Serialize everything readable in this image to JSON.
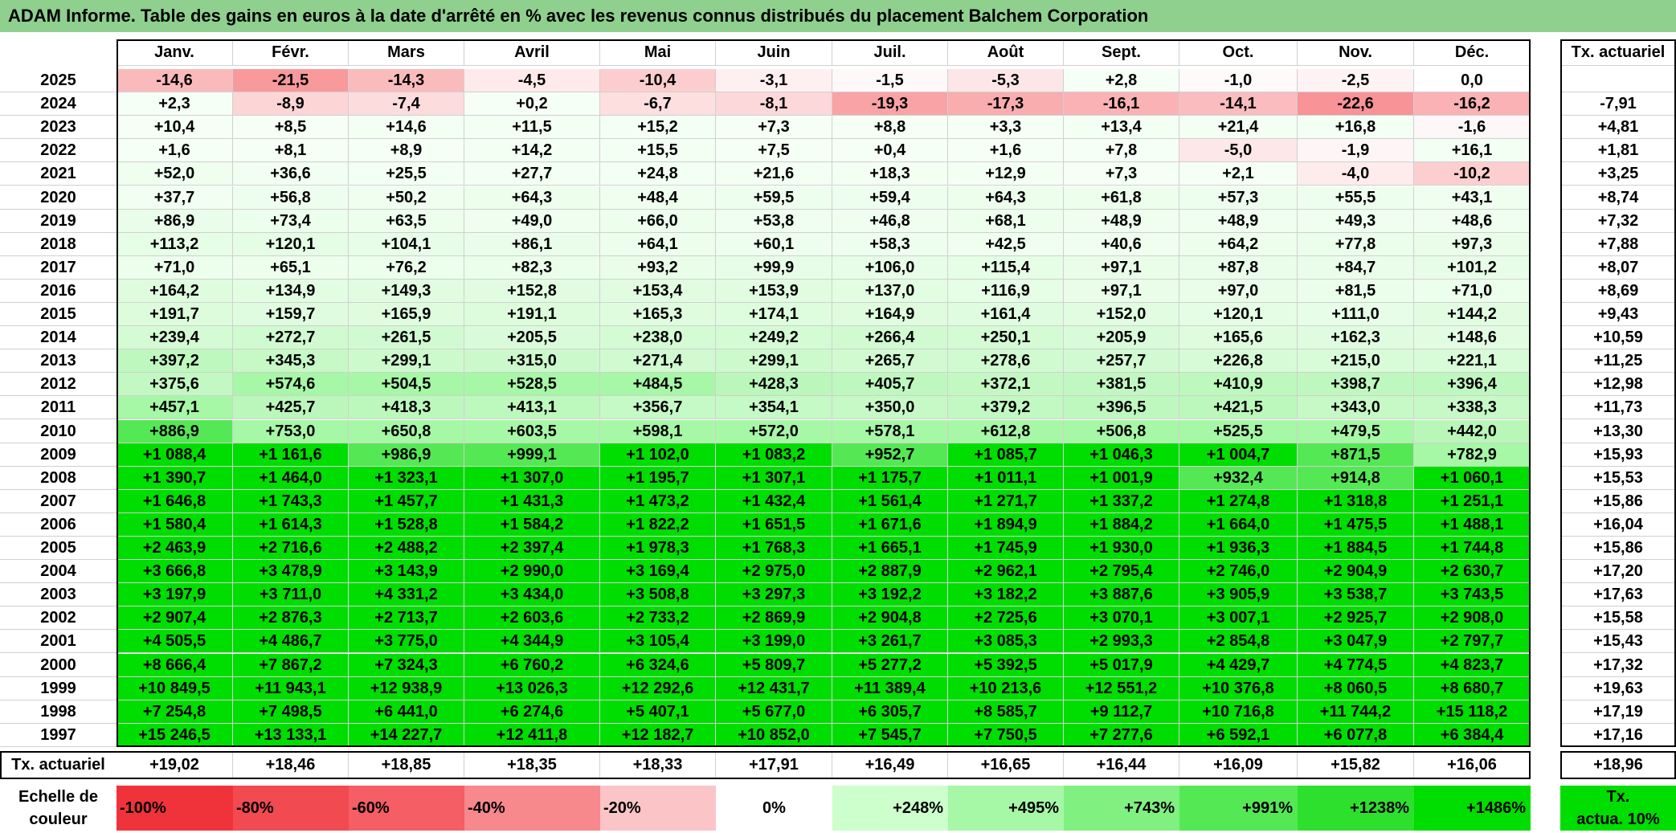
{
  "title": "ADAM Informe. Table des gains en euros à la date d'arrêté en % avec les revenus connus distribués du placement Balchem Corporation",
  "chart_data": {
    "type": "heatmap",
    "columns": [
      "Janv.",
      "Févr.",
      "Mars",
      "Avril",
      "Mai",
      "Juin",
      "Juil.",
      "Août",
      "Sept.",
      "Oct.",
      "Nov.",
      "Déc."
    ],
    "annual_header": "Tx. actuariel",
    "rows": [
      {
        "year": "2025",
        "values": [
          "-14,6",
          "-21,5",
          "-14,3",
          "-4,5",
          "-10,4",
          "-3,1",
          "-1,5",
          "-5,3",
          "+2,8",
          "-1,0",
          "-2,5",
          "0,0"
        ],
        "rate": ""
      },
      {
        "year": "2024",
        "values": [
          "+2,3",
          "-8,9",
          "-7,4",
          "+0,2",
          "-6,7",
          "-8,1",
          "-19,3",
          "-17,3",
          "-16,1",
          "-14,1",
          "-22,6",
          "-16,2"
        ],
        "rate": "-7,91"
      },
      {
        "year": "2023",
        "values": [
          "+10,4",
          "+8,5",
          "+14,6",
          "+11,5",
          "+15,2",
          "+7,3",
          "+8,8",
          "+3,3",
          "+13,4",
          "+21,4",
          "+16,8",
          "-1,6"
        ],
        "rate": "+4,81"
      },
      {
        "year": "2022",
        "values": [
          "+1,6",
          "+8,1",
          "+8,9",
          "+14,2",
          "+15,5",
          "+7,5",
          "+0,4",
          "+1,6",
          "+7,8",
          "-5,0",
          "-1,9",
          "+16,1"
        ],
        "rate": "+1,81"
      },
      {
        "year": "2021",
        "values": [
          "+52,0",
          "+36,6",
          "+25,5",
          "+27,7",
          "+24,8",
          "+21,6",
          "+18,3",
          "+12,9",
          "+7,3",
          "+2,1",
          "-4,0",
          "-10,2"
        ],
        "rate": "+3,25"
      },
      {
        "year": "2020",
        "values": [
          "+37,7",
          "+56,8",
          "+50,2",
          "+64,3",
          "+48,4",
          "+59,5",
          "+59,4",
          "+64,3",
          "+61,8",
          "+57,3",
          "+55,5",
          "+43,1"
        ],
        "rate": "+8,74"
      },
      {
        "year": "2019",
        "values": [
          "+86,9",
          "+73,4",
          "+63,5",
          "+49,0",
          "+66,0",
          "+53,8",
          "+46,8",
          "+68,1",
          "+48,9",
          "+48,9",
          "+49,3",
          "+48,6"
        ],
        "rate": "+7,32"
      },
      {
        "year": "2018",
        "values": [
          "+113,2",
          "+120,1",
          "+104,1",
          "+86,1",
          "+64,1",
          "+60,1",
          "+58,3",
          "+42,5",
          "+40,6",
          "+64,2",
          "+77,8",
          "+97,3"
        ],
        "rate": "+7,88"
      },
      {
        "year": "2017",
        "values": [
          "+71,0",
          "+65,1",
          "+76,2",
          "+82,3",
          "+93,2",
          "+99,9",
          "+106,0",
          "+115,4",
          "+97,1",
          "+87,8",
          "+84,7",
          "+101,2"
        ],
        "rate": "+8,07"
      },
      {
        "year": "2016",
        "values": [
          "+164,2",
          "+134,9",
          "+149,3",
          "+152,8",
          "+153,4",
          "+153,9",
          "+137,0",
          "+116,9",
          "+97,1",
          "+97,0",
          "+81,5",
          "+71,0"
        ],
        "rate": "+8,69"
      },
      {
        "year": "2015",
        "values": [
          "+191,7",
          "+159,7",
          "+165,9",
          "+191,1",
          "+165,3",
          "+174,1",
          "+164,9",
          "+161,4",
          "+152,0",
          "+120,1",
          "+111,0",
          "+144,2"
        ],
        "rate": "+9,43"
      },
      {
        "year": "2014",
        "values": [
          "+239,4",
          "+272,7",
          "+261,5",
          "+205,5",
          "+238,0",
          "+249,2",
          "+266,4",
          "+250,1",
          "+205,9",
          "+165,6",
          "+162,3",
          "+148,6"
        ],
        "rate": "+10,59"
      },
      {
        "year": "2013",
        "values": [
          "+397,2",
          "+345,3",
          "+299,1",
          "+315,0",
          "+271,4",
          "+299,1",
          "+265,7",
          "+278,6",
          "+257,7",
          "+226,8",
          "+215,0",
          "+221,1"
        ],
        "rate": "+11,25"
      },
      {
        "year": "2012",
        "values": [
          "+375,6",
          "+574,6",
          "+504,5",
          "+528,5",
          "+484,5",
          "+428,3",
          "+405,7",
          "+372,1",
          "+381,5",
          "+410,9",
          "+398,7",
          "+396,4"
        ],
        "rate": "+12,98"
      },
      {
        "year": "2011",
        "values": [
          "+457,1",
          "+425,7",
          "+418,3",
          "+413,1",
          "+356,7",
          "+354,1",
          "+350,0",
          "+379,2",
          "+396,5",
          "+421,5",
          "+343,0",
          "+338,3"
        ],
        "rate": "+11,73"
      },
      {
        "year": "2010",
        "values": [
          "+886,9",
          "+753,0",
          "+650,8",
          "+603,5",
          "+598,1",
          "+572,0",
          "+578,1",
          "+612,8",
          "+506,8",
          "+525,5",
          "+479,5",
          "+442,0"
        ],
        "rate": "+13,30"
      },
      {
        "year": "2009",
        "values": [
          "+1 088,4",
          "+1 161,6",
          "+986,9",
          "+999,1",
          "+1 102,0",
          "+1 083,2",
          "+952,7",
          "+1 085,7",
          "+1 046,3",
          "+1 004,7",
          "+871,5",
          "+782,9"
        ],
        "rate": "+15,93"
      },
      {
        "year": "2008",
        "values": [
          "+1 390,7",
          "+1 464,0",
          "+1 323,1",
          "+1 307,0",
          "+1 195,7",
          "+1 307,1",
          "+1 175,7",
          "+1 011,1",
          "+1 001,9",
          "+932,4",
          "+914,8",
          "+1 060,1"
        ],
        "rate": "+15,53"
      },
      {
        "year": "2007",
        "values": [
          "+1 646,8",
          "+1 743,3",
          "+1 457,7",
          "+1 431,3",
          "+1 473,2",
          "+1 432,4",
          "+1 561,4",
          "+1 271,7",
          "+1 337,2",
          "+1 274,8",
          "+1 318,8",
          "+1 251,1"
        ],
        "rate": "+15,86"
      },
      {
        "year": "2006",
        "values": [
          "+1 580,4",
          "+1 614,3",
          "+1 528,8",
          "+1 584,2",
          "+1 822,2",
          "+1 651,5",
          "+1 671,6",
          "+1 894,9",
          "+1 884,2",
          "+1 664,0",
          "+1 475,5",
          "+1 488,1"
        ],
        "rate": "+16,04"
      },
      {
        "year": "2005",
        "values": [
          "+2 463,9",
          "+2 716,6",
          "+2 488,2",
          "+2 397,4",
          "+1 978,3",
          "+1 768,3",
          "+1 665,1",
          "+1 745,9",
          "+1 930,0",
          "+1 936,3",
          "+1 884,5",
          "+1 744,8"
        ],
        "rate": "+15,86"
      },
      {
        "year": "2004",
        "values": [
          "+3 666,8",
          "+3 478,9",
          "+3 143,9",
          "+2 990,0",
          "+3 169,4",
          "+2 975,0",
          "+2 887,9",
          "+2 962,1",
          "+2 795,4",
          "+2 746,0",
          "+2 904,9",
          "+2 630,7"
        ],
        "rate": "+17,20"
      },
      {
        "year": "2003",
        "values": [
          "+3 197,9",
          "+3 711,0",
          "+4 331,2",
          "+3 434,0",
          "+3 508,8",
          "+3 297,3",
          "+3 192,2",
          "+3 182,2",
          "+3 887,6",
          "+3 905,9",
          "+3 538,7",
          "+3 743,5"
        ],
        "rate": "+17,63"
      },
      {
        "year": "2002",
        "values": [
          "+2 907,4",
          "+2 876,3",
          "+2 713,7",
          "+2 603,6",
          "+2 733,2",
          "+2 869,9",
          "+2 904,8",
          "+2 725,6",
          "+3 070,1",
          "+3 007,1",
          "+2 925,7",
          "+2 908,0"
        ],
        "rate": "+15,58"
      },
      {
        "year": "2001",
        "values": [
          "+4 505,5",
          "+4 486,7",
          "+3 775,0",
          "+4 344,9",
          "+3 105,4",
          "+3 199,0",
          "+3 261,7",
          "+3 085,3",
          "+2 993,3",
          "+2 854,8",
          "+3 047,9",
          "+2 797,7"
        ],
        "rate": "+15,43"
      },
      {
        "year": "2000",
        "values": [
          "+8 666,4",
          "+7 867,2",
          "+7 324,3",
          "+6 760,2",
          "+6 324,6",
          "+5 809,7",
          "+5 277,2",
          "+5 392,5",
          "+5 017,9",
          "+4 429,7",
          "+4 774,5",
          "+4 823,7"
        ],
        "rate": "+17,32"
      },
      {
        "year": "1999",
        "values": [
          "+10 849,5",
          "+11 943,1",
          "+12 938,9",
          "+13 026,3",
          "+12 292,6",
          "+12 431,7",
          "+11 389,4",
          "+10 213,6",
          "+12 551,2",
          "+10 376,8",
          "+8 060,5",
          "+8 680,7"
        ],
        "rate": "+19,63"
      },
      {
        "year": "1998",
        "values": [
          "+7 254,8",
          "+7 498,5",
          "+6 441,0",
          "+6 274,6",
          "+5 407,1",
          "+5 677,0",
          "+6 305,7",
          "+8 585,7",
          "+9 112,7",
          "+10 716,8",
          "+11 744,2",
          "+15 118,2"
        ],
        "rate": "+17,19"
      },
      {
        "year": "1997",
        "values": [
          "+15 246,5",
          "+13 133,1",
          "+14 227,7",
          "+12 411,8",
          "+12 182,7",
          "+10 852,0",
          "+7 545,7",
          "+7 750,5",
          "+7 277,6",
          "+6 592,1",
          "+6 077,8",
          "+6 384,4"
        ],
        "rate": "+17,16"
      }
    ],
    "footer": {
      "label": "Tx. actuariel",
      "values": [
        "+19,02",
        "+18,46",
        "+18,85",
        "+18,35",
        "+18,33",
        "+17,91",
        "+16,49",
        "+16,65",
        "+16,44",
        "+16,09",
        "+15,82",
        "+16,06"
      ],
      "total": "+18,96"
    },
    "scale": {
      "label_line1": "Echelle de",
      "label_line2": "couleur",
      "steps": [
        {
          "text": "-100%",
          "color": "#f0333b",
          "align": "left"
        },
        {
          "text": "-80%",
          "color": "#f24a51",
          "align": "left"
        },
        {
          "text": "-60%",
          "color": "#f55e64",
          "align": "left"
        },
        {
          "text": "-40%",
          "color": "#f7888c",
          "align": "left"
        },
        {
          "text": "-20%",
          "color": "#fbc4c6",
          "align": "left"
        },
        {
          "text": "0%",
          "color": "#ffffff",
          "align": "center"
        },
        {
          "text": "+248%",
          "color": "#ccffcc",
          "align": "right"
        },
        {
          "text": "+495%",
          "color": "#a6f7a6",
          "align": "right"
        },
        {
          "text": "+743%",
          "color": "#80f080",
          "align": "right"
        },
        {
          "text": "+991%",
          "color": "#55e855",
          "align": "right"
        },
        {
          "text": "+1238%",
          "color": "#2ee02e",
          "align": "right"
        },
        {
          "text": "+1486%",
          "color": "#00dd00",
          "align": "right"
        }
      ],
      "extra_line1": "Tx.",
      "extra_line2": "actua. 10%",
      "extra_color": "#00dd00"
    }
  }
}
